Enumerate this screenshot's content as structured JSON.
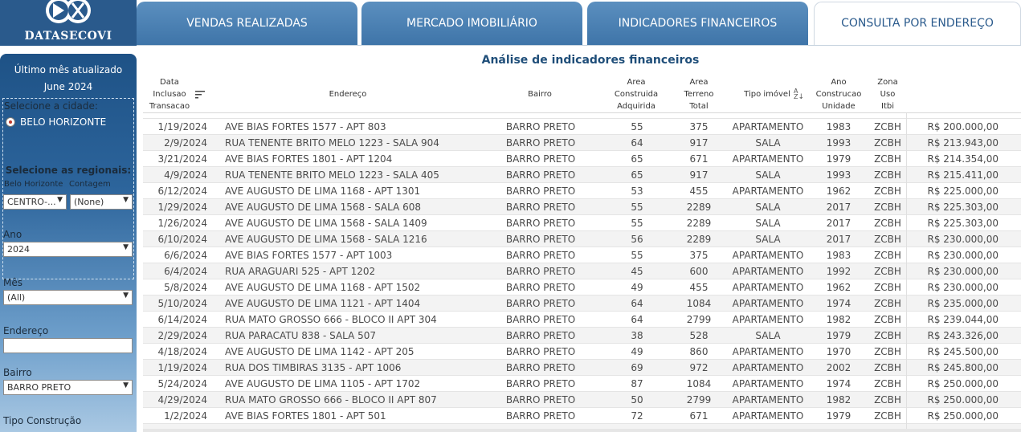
{
  "logo": {
    "text": "DATASECOVI"
  },
  "tabs": [
    {
      "label": "VENDAS REALIZADAS"
    },
    {
      "label": "MERCADO IMOBILIÁRIO"
    },
    {
      "label": "INDICADORES FINANCEIROS"
    },
    {
      "label": "CONSULTA POR ENDEREÇO",
      "active": true
    }
  ],
  "sidebar": {
    "last_update_title": "Último mês atualizado",
    "last_update_value": "June 2024",
    "city_label": "Selecione a cidade:",
    "city_option": "BELO HORIZONTE",
    "regional_label": "Selecione as regionais:",
    "bh_label": "Belo Horizonte",
    "contagem_label": "Contagem",
    "bh_value": "CENTRO-...",
    "contagem_value": "(None)",
    "ano_label": "Ano",
    "ano_value": "2024",
    "mes_label": "Mês",
    "mes_value": "(All)",
    "endereco_label": "Endereço",
    "endereco_value": "",
    "bairro_label": "Bairro",
    "bairro_value": "BARRO PRETO",
    "tipo_label": "Tipo Construção"
  },
  "main": {
    "title": "Análise de indicadores financeiros",
    "headers": {
      "data": [
        "Data",
        "Inclusao",
        "Transacao"
      ],
      "endereco": [
        "Endereço"
      ],
      "bairro": [
        "Bairro"
      ],
      "area_construida": [
        "Area",
        "Construida",
        "Adquirida"
      ],
      "area_terreno": [
        "Area",
        "Terreno",
        "Total"
      ],
      "tipo_imovel": [
        "Tipo imóvel"
      ],
      "ano": [
        "Ano",
        "Construcao",
        "Unidade"
      ],
      "zona": [
        "Zona",
        "Uso",
        "Itbi"
      ]
    },
    "rows": [
      [
        "1/19/2024",
        "AVE BIAS FORTES 1577  -  APT 803",
        "BARRO PRETO",
        "55",
        "375",
        "APARTAMENTO",
        "1983",
        "ZCBH",
        "R$ 200.000,00"
      ],
      [
        "2/9/2024",
        "RUA TENENTE BRITO MELO 1223  -  SALA 904",
        "BARRO PRETO",
        "64",
        "917",
        "SALA",
        "1993",
        "ZCBH",
        "R$ 213.943,00"
      ],
      [
        "3/21/2024",
        "AVE BIAS FORTES 1801  -  APT 1204",
        "BARRO PRETO",
        "65",
        "671",
        "APARTAMENTO",
        "1979",
        "ZCBH",
        "R$ 214.354,00"
      ],
      [
        "4/9/2024",
        "RUA TENENTE BRITO MELO 1223  -  SALA 405",
        "BARRO PRETO",
        "65",
        "917",
        "SALA",
        "1993",
        "ZCBH",
        "R$ 215.411,00"
      ],
      [
        "6/12/2024",
        "AVE AUGUSTO DE LIMA 1168  -  APT 1301",
        "BARRO PRETO",
        "53",
        "455",
        "APARTAMENTO",
        "1962",
        "ZCBH",
        "R$ 225.000,00"
      ],
      [
        "1/29/2024",
        "AVE AUGUSTO DE LIMA 1568  -  SALA 608",
        "BARRO PRETO",
        "55",
        "2289",
        "SALA",
        "2017",
        "ZCBH",
        "R$ 225.303,00"
      ],
      [
        "1/26/2024",
        "AVE AUGUSTO DE LIMA 1568  -  SALA 1409",
        "BARRO PRETO",
        "55",
        "2289",
        "SALA",
        "2017",
        "ZCBH",
        "R$ 225.303,00"
      ],
      [
        "6/10/2024",
        "AVE AUGUSTO DE LIMA 1568  -  SALA 1216",
        "BARRO PRETO",
        "56",
        "2289",
        "SALA",
        "2017",
        "ZCBH",
        "R$ 230.000,00"
      ],
      [
        "6/6/2024",
        "AVE BIAS FORTES 1577  -  APT 1003",
        "BARRO PRETO",
        "55",
        "375",
        "APARTAMENTO",
        "1983",
        "ZCBH",
        "R$ 230.000,00"
      ],
      [
        "6/4/2024",
        "RUA ARAGUARI 525  -  APT 1202",
        "BARRO PRETO",
        "45",
        "600",
        "APARTAMENTO",
        "1992",
        "ZCBH",
        "R$ 230.000,00"
      ],
      [
        "5/8/2024",
        "AVE AUGUSTO DE LIMA 1168  -  APT 1502",
        "BARRO PRETO",
        "49",
        "455",
        "APARTAMENTO",
        "1962",
        "ZCBH",
        "R$ 230.000,00"
      ],
      [
        "5/10/2024",
        "AVE AUGUSTO DE LIMA 1121  -  APT 1404",
        "BARRO PRETO",
        "64",
        "1084",
        "APARTAMENTO",
        "1974",
        "ZCBH",
        "R$ 235.000,00"
      ],
      [
        "6/14/2024",
        "RUA MATO GROSSO 666  -  BLOCO II APT 304",
        "BARRO PRETO",
        "64",
        "2799",
        "APARTAMENTO",
        "1982",
        "ZCBH",
        "R$ 239.044,00"
      ],
      [
        "2/29/2024",
        "RUA PARACATU 838  -  SALA 507",
        "BARRO PRETO",
        "38",
        "528",
        "SALA",
        "1979",
        "ZCBH",
        "R$ 243.326,00"
      ],
      [
        "4/18/2024",
        "AVE AUGUSTO DE LIMA 1142  -  APT 205",
        "BARRO PRETO",
        "49",
        "860",
        "APARTAMENTO",
        "1970",
        "ZCBH",
        "R$ 245.500,00"
      ],
      [
        "1/19/2024",
        "RUA DOS TIMBIRAS 3135  -  APT 1006",
        "BARRO PRETO",
        "69",
        "972",
        "APARTAMENTO",
        "2002",
        "ZCBH",
        "R$ 245.800,00"
      ],
      [
        "5/24/2024",
        "AVE AUGUSTO DE LIMA 1105  -  APT 1702",
        "BARRO PRETO",
        "87",
        "1084",
        "APARTAMENTO",
        "1974",
        "ZCBH",
        "R$ 250.000,00"
      ],
      [
        "4/29/2024",
        "RUA MATO GROSSO 666  -  BLOCO II APT 807",
        "BARRO PRETO",
        "50",
        "2799",
        "APARTAMENTO",
        "1982",
        "ZCBH",
        "R$ 250.000,00"
      ],
      [
        "1/2/2024",
        "AVE BIAS FORTES 1801  -  APT 501",
        "BARRO PRETO",
        "72",
        "671",
        "APARTAMENTO",
        "1979",
        "ZCBH",
        "R$ 250.000,00"
      ]
    ]
  }
}
